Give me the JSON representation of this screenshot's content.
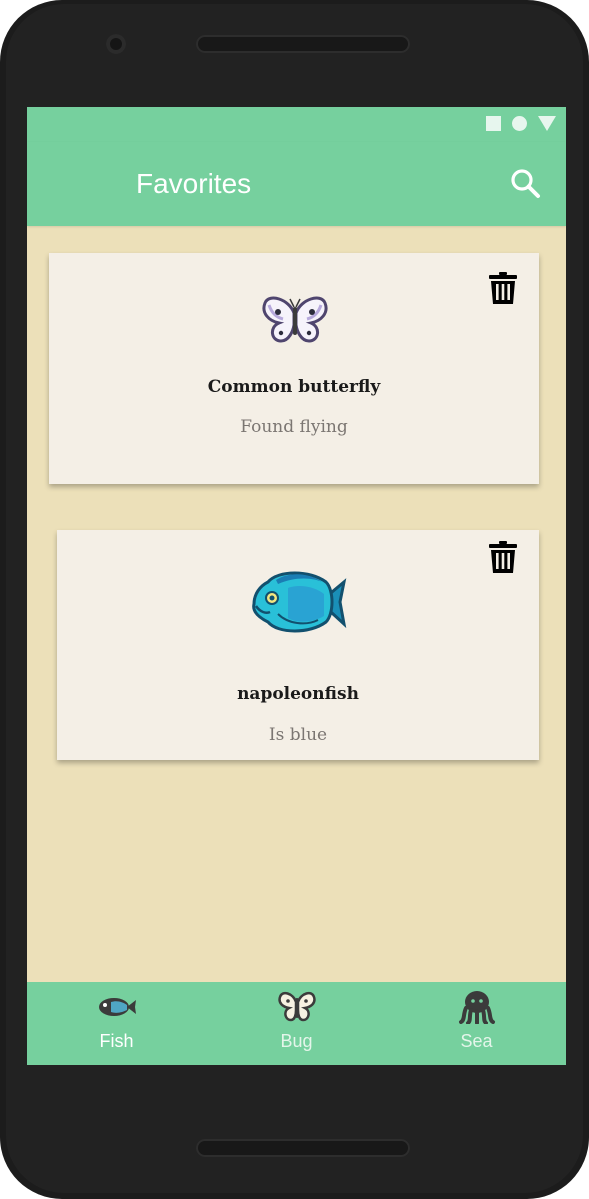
{
  "status_bar": {
    "icons": [
      "square-icon",
      "circle-icon",
      "triangle-down-icon"
    ]
  },
  "app_bar": {
    "title": "Favorites",
    "action_icon": "search-icon",
    "color": "#76d09e"
  },
  "favorites": [
    {
      "name": "Common butterfly",
      "description": "Found flying",
      "image_icon": "butterfly-icon",
      "action_icon": "trash-icon"
    },
    {
      "name": "napoleonfish",
      "description": "Is blue",
      "image_icon": "napoleonfish-icon",
      "action_icon": "trash-icon"
    }
  ],
  "bottom_nav": {
    "items": [
      {
        "label": "Fish",
        "icon": "fish-icon",
        "selected": true
      },
      {
        "label": "Bug",
        "icon": "bug-icon",
        "selected": false
      },
      {
        "label": "Sea",
        "icon": "octopus-icon",
        "selected": false
      }
    ]
  },
  "colors": {
    "accent": "#76d09e",
    "background": "#ece0b9",
    "card": "#f4efe6"
  }
}
